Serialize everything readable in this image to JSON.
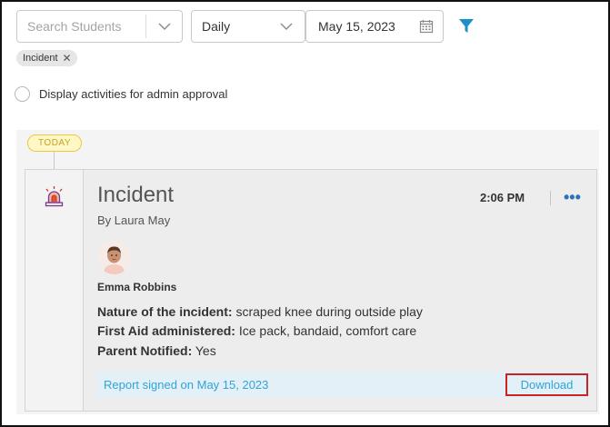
{
  "filters": {
    "search_placeholder": "Search Students",
    "period_value": "Daily",
    "date_value": "May 15, 2023"
  },
  "chip": {
    "label": "Incident"
  },
  "admin_toggle": {
    "label": "Display activities for admin approval"
  },
  "timeline": {
    "today_label": "TODAY"
  },
  "activity": {
    "title": "Incident",
    "author": "By Laura May",
    "time": "2:06 PM",
    "student_name": "Emma Robbins",
    "details": [
      {
        "label": "Nature of the incident:",
        "value": "scraped knee during outside play"
      },
      {
        "label": "First Aid administered:",
        "value": "Ice pack, bandaid, comfort care"
      },
      {
        "label": "Parent Notified:",
        "value": "Yes"
      }
    ],
    "signed_text": "Report signed on May 15, 2023",
    "download_label": "Download"
  },
  "colors": {
    "accent_blue": "#2fa4d8",
    "filter_icon": "#1d8fc9",
    "today_badge_bg": "#fff7c6",
    "today_badge_border": "#e9c74a",
    "alarm_icon": "#c0392b"
  }
}
